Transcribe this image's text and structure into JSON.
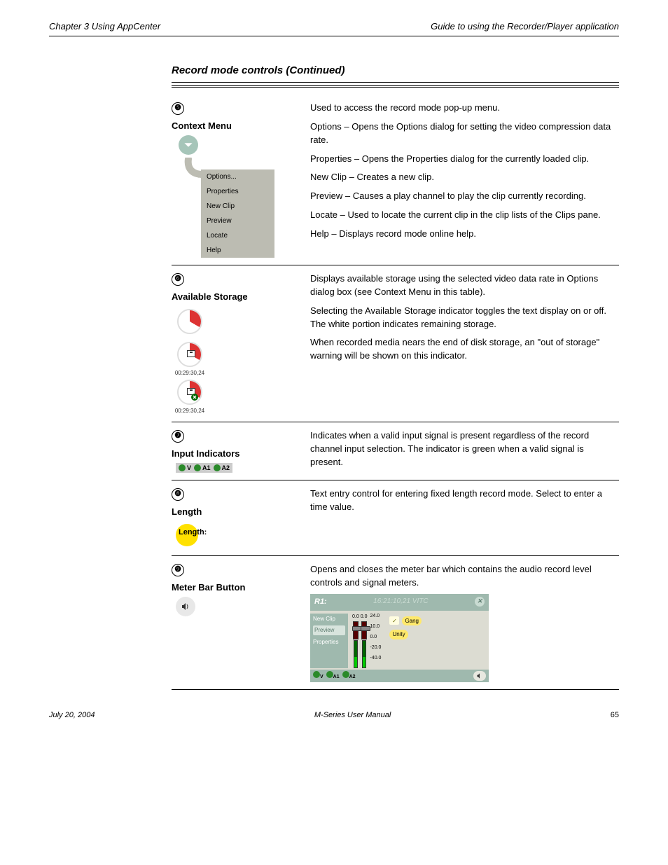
{
  "header": {
    "left": "Chapter 3 Using AppCenter",
    "right": "Guide to using the Recorder/Player application"
  },
  "section_title": "Record mode controls (Continued)",
  "footer": {
    "date": "July 20, 2004",
    "book": "M-Series User Manual",
    "page": "65"
  },
  "items": [
    {
      "num": "❺",
      "name": "Context Menu",
      "menu": [
        "Options...",
        "Properties",
        "New Clip",
        "Preview",
        "Locate",
        "Help"
      ],
      "desc": [
        "Used to access the record mode pop-up menu.",
        "Options – Opens the Options dialog for setting the video compression data rate.",
        "Properties – Opens the Properties dialog for the currently loaded clip.",
        "New Clip – Creates a new clip.",
        "Preview – Causes a play channel to play the clip currently recording.",
        "Locate – Used to locate the current clip in the clip lists of the Clips pane.",
        "Help – Displays record mode online help."
      ]
    },
    {
      "num": "❻",
      "name": "Available Storage",
      "tc": "00:29:30,24",
      "desc": [
        "Displays available storage using the selected video data rate in Options dialog box (see Context Menu in this table).",
        "Selecting the Available Storage indicator toggles the text display on or off. The white portion indicates remaining storage.",
        "When recorded media nears the end of disk storage, an \"out of storage\" warning will be shown on this indicator."
      ]
    },
    {
      "num": "❼",
      "name": "Input Indicators",
      "tracks": [
        "V",
        "A1",
        "A2"
      ],
      "desc": [
        "Indicates when a valid input signal is present regardless of the record channel input selection. The indicator is green when a valid signal is present."
      ]
    },
    {
      "num": "❽",
      "name": "Length",
      "desc": [
        "Text entry control for entering fixed length record mode. Select to enter a time value."
      ]
    },
    {
      "num": "❾",
      "name": "Meter Bar Button",
      "panel": {
        "title": "R1:",
        "timecode": "16:21:10,21 VITC",
        "left_items": [
          "New Clip",
          "Preview",
          "Properties"
        ],
        "meter_tops": [
          "0.0",
          "0.0"
        ],
        "scale": [
          "24.0",
          "10.0",
          "0.0",
          "-20.0",
          "-40.0"
        ],
        "gang": "Gang",
        "unity": "Unity",
        "foot_tracks": [
          "V",
          "A1",
          "A2"
        ]
      },
      "desc": [
        "Opens and closes the meter bar which contains the audio record level controls and signal meters."
      ]
    }
  ]
}
